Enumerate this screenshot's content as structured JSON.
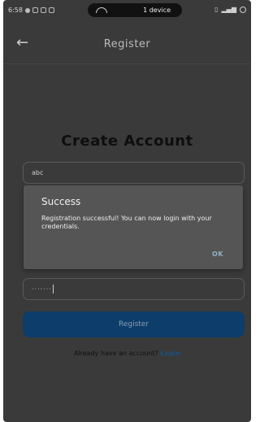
{
  "status_bar": {
    "time": "6:58",
    "cast_label": "1 device"
  },
  "app_bar": {
    "title": "Register"
  },
  "form": {
    "heading": "Create Account",
    "name_value": "abc",
    "password_value": "·······",
    "register_label": "Register",
    "login_prompt": "Already have an account?",
    "login_link": "Login"
  },
  "dialog": {
    "title": "Success",
    "message": "Registration successful! You can now login with your credentials.",
    "ok_label": "OK"
  }
}
